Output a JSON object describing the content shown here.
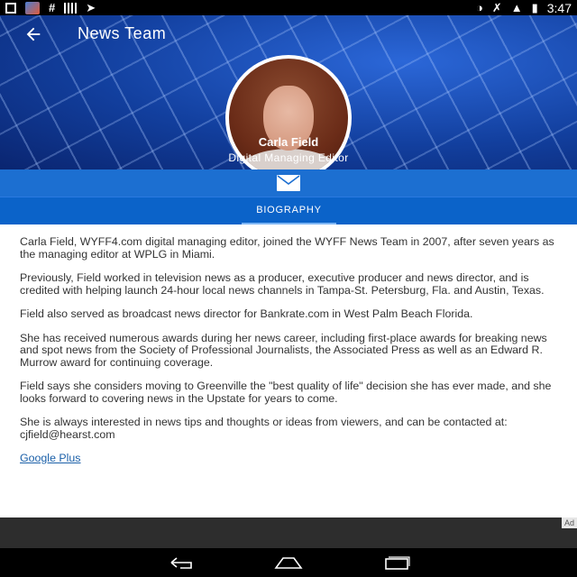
{
  "status_bar": {
    "time": "3:47",
    "left_icons": [
      "download-icon",
      "photo-icon",
      "hash-icon",
      "barcode-icon",
      "arrow-icon"
    ],
    "right_icons": [
      "vibrate-icon",
      "mute-icon",
      "wifi-icon",
      "battery-icon"
    ]
  },
  "header": {
    "title": "News Team",
    "back_icon": "arrow-left-icon"
  },
  "profile": {
    "name": "Carla Field",
    "role": "Digital Managing Editor"
  },
  "actions": {
    "mail_icon": "envelope-icon"
  },
  "tabs": [
    {
      "label": "BIOGRAPHY",
      "active": true
    }
  ],
  "biography": {
    "paragraphs": [
      "Carla Field, WYFF4.com digital managing editor, joined the WYFF News Team in 2007, after seven years as the managing editor at WPLG in Miami.",
      "Previously, Field worked in television news as a producer, executive producer and news director, and is credited with helping launch 24-hour local news channels in Tampa-St. Petersburg, Fla. and Austin, Texas.",
      "Field also served as broadcast news director for Bankrate.com in West Palm Beach Florida.",
      "She has received numerous awards during her news career, including first-place awards for breaking news and spot news from the Society of Professional Journalists, the Associated Press as well as an Edward R. Murrow award for continuing coverage.",
      "Field says she considers moving to Greenville the \"best quality of life\" decision she has ever made, and she looks forward to covering news in the Upstate for years to come.",
      "She is always interested in news tips and thoughts or ideas from viewers, and can be contacted at: cjfield@hearst.com"
    ],
    "link": "Google Plus"
  },
  "ad": {
    "label": "Ad"
  },
  "colors": {
    "accent": "#1c6fd1",
    "tab_bar": "#0b63c9",
    "link": "#1a5fa8"
  }
}
